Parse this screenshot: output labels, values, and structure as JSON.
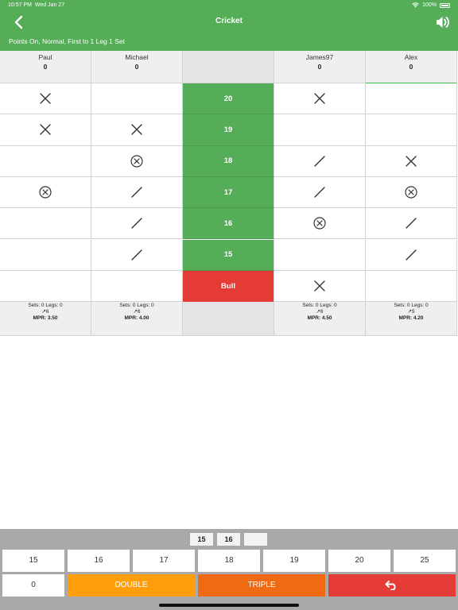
{
  "statusbar": {
    "time": "10:57 PM",
    "date": "Wed Jan 27",
    "battery": "100%"
  },
  "header": {
    "title": "Cricket",
    "subtitle": "Points On, Normal, First to 1 Leg 1 Set"
  },
  "numbers": [
    "20",
    "19",
    "18",
    "17",
    "16",
    "15",
    "Bull"
  ],
  "players": [
    {
      "name": "Paul",
      "score": "0",
      "active": false,
      "marks": [
        "x",
        "x",
        "",
        "xc",
        "",
        "",
        ""
      ],
      "stats": {
        "sets_legs": "Sets: 0 Legs: 0",
        "darts": "↗6",
        "mpr": "MPR: 3.50"
      }
    },
    {
      "name": "Michael",
      "score": "0",
      "active": false,
      "marks": [
        "",
        "x",
        "xc",
        "/",
        "/",
        "/",
        ""
      ],
      "stats": {
        "sets_legs": "Sets: 0 Legs: 0",
        "darts": "↗6",
        "mpr": "MPR: 4.00"
      }
    },
    {
      "name": "James97",
      "score": "0",
      "active": false,
      "marks": [
        "x",
        "",
        "/",
        "/",
        "xc",
        "",
        "x"
      ],
      "stats": {
        "sets_legs": "Sets: 0 Legs: 0",
        "darts": "↗6",
        "mpr": "MPR: 4.50"
      }
    },
    {
      "name": "Alex",
      "score": "0",
      "active": true,
      "marks": [
        "",
        "",
        "x",
        "xc",
        "/",
        "/",
        ""
      ],
      "stats": {
        "sets_legs": "Sets: 0 Legs: 0",
        "darts": "↗5",
        "mpr": "MPR: 4.20"
      }
    }
  ],
  "current_darts": [
    "15",
    "16",
    ""
  ],
  "keypad": {
    "row1": [
      "15",
      "16",
      "17",
      "18",
      "19",
      "20",
      "25"
    ],
    "zero": "0",
    "double": "DOUBLE",
    "triple": "TRIPLE",
    "undo_icon": "undo-icon"
  },
  "colors": {
    "header": "#56ad58",
    "bull": "#e53b36",
    "double": "#ff9e0a",
    "triple": "#ef6a12",
    "active": "#3dbf50"
  }
}
